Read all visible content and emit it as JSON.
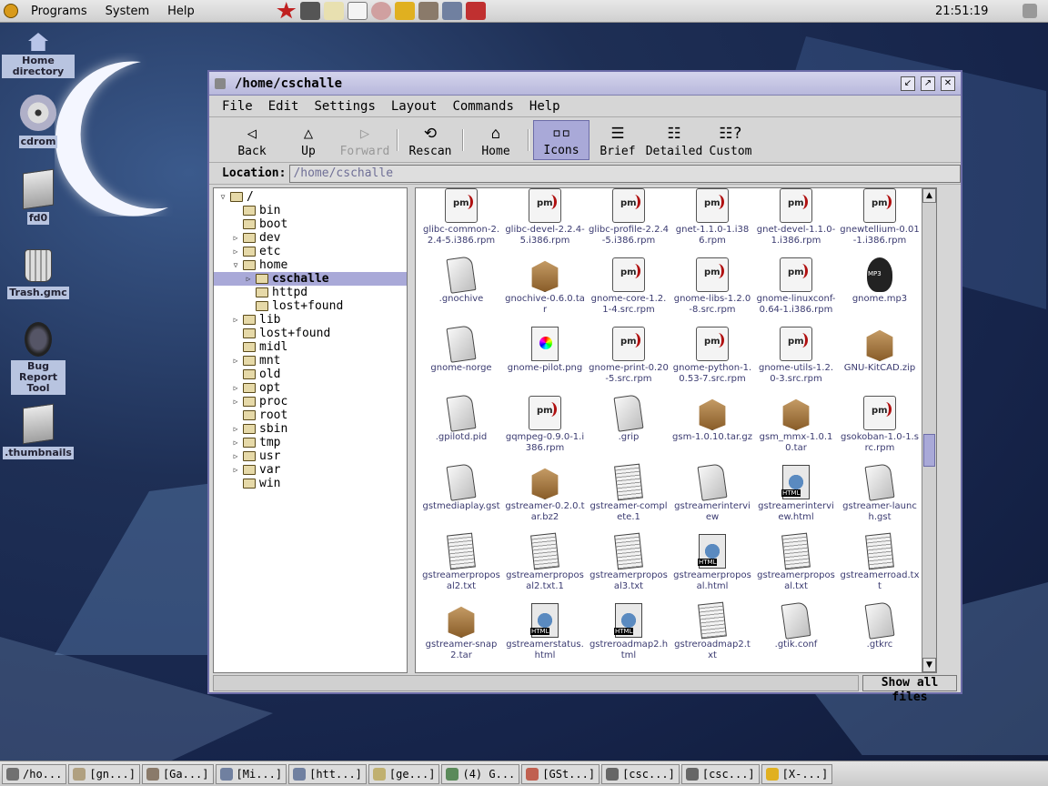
{
  "top_panel": {
    "menus": [
      "Programs",
      "System",
      "Help"
    ],
    "clock": "21:51:19"
  },
  "desktop_icons": [
    {
      "label": "Home directory",
      "icon": "home-icon"
    },
    {
      "label": "cdrom",
      "icon": "cdrom-icon"
    },
    {
      "label": "fd0",
      "icon": "floppy-folder-icon"
    },
    {
      "label": "Trash.gmc",
      "icon": "trash-icon"
    },
    {
      "label": "Bug Report Tool",
      "icon": "bug-icon"
    },
    {
      "label": ".thumbnails",
      "icon": "folder-icon"
    }
  ],
  "window": {
    "title": "/home/cschalle",
    "menus": [
      "File",
      "Edit",
      "Settings",
      "Layout",
      "Commands",
      "Help"
    ],
    "toolbar": [
      {
        "label": "Back",
        "icon": "back-arrow-icon"
      },
      {
        "label": "Up",
        "icon": "up-arrow-icon"
      },
      {
        "label": "Forward",
        "icon": "forward-arrow-icon",
        "disabled": true
      },
      {
        "label": "Rescan",
        "icon": "rescan-icon"
      },
      {
        "label": "Home",
        "icon": "home-icon"
      },
      {
        "label": "Icons",
        "icon": "icons-view-icon",
        "active": true
      },
      {
        "label": "Brief",
        "icon": "brief-view-icon"
      },
      {
        "label": "Detailed",
        "icon": "detailed-view-icon"
      },
      {
        "label": "Custom",
        "icon": "custom-view-icon"
      }
    ],
    "location_label": "Location:",
    "location_value": "/home/cschalle",
    "tree": [
      {
        "name": "/",
        "level": 0,
        "expander": "▽"
      },
      {
        "name": "bin",
        "level": 1,
        "expander": ""
      },
      {
        "name": "boot",
        "level": 1,
        "expander": ""
      },
      {
        "name": "dev",
        "level": 1,
        "expander": "▷"
      },
      {
        "name": "etc",
        "level": 1,
        "expander": "▷"
      },
      {
        "name": "home",
        "level": 1,
        "expander": "▽"
      },
      {
        "name": "cschalle",
        "level": 2,
        "expander": "▷",
        "selected": true
      },
      {
        "name": "httpd",
        "level": 2,
        "expander": ""
      },
      {
        "name": "lost+found",
        "level": 2,
        "expander": ""
      },
      {
        "name": "lib",
        "level": 1,
        "expander": "▷"
      },
      {
        "name": "lost+found",
        "level": 1,
        "expander": ""
      },
      {
        "name": "midl",
        "level": 1,
        "expander": ""
      },
      {
        "name": "mnt",
        "level": 1,
        "expander": "▷"
      },
      {
        "name": "old",
        "level": 1,
        "expander": ""
      },
      {
        "name": "opt",
        "level": 1,
        "expander": "▷"
      },
      {
        "name": "proc",
        "level": 1,
        "expander": "▷"
      },
      {
        "name": "root",
        "level": 1,
        "expander": ""
      },
      {
        "name": "sbin",
        "level": 1,
        "expander": "▷"
      },
      {
        "name": "tmp",
        "level": 1,
        "expander": "▷"
      },
      {
        "name": "usr",
        "level": 1,
        "expander": "▷"
      },
      {
        "name": "var",
        "level": 1,
        "expander": "▷"
      },
      {
        "name": "win",
        "level": 1,
        "expander": ""
      }
    ],
    "files": [
      {
        "name": "glibc-common-2.2.4-5.i386.rpm",
        "type": "rpm"
      },
      {
        "name": "glibc-devel-2.2.4-5.i386.rpm",
        "type": "rpm"
      },
      {
        "name": "glibc-profile-2.2.4-5.i386.rpm",
        "type": "rpm"
      },
      {
        "name": "gnet-1.1.0-1.i386.rpm",
        "type": "rpm"
      },
      {
        "name": "gnet-devel-1.1.0-1.i386.rpm",
        "type": "rpm"
      },
      {
        "name": "gnewtellium-0.01-1.i386.rpm",
        "type": "rpm"
      },
      {
        "name": ".gnochive",
        "type": "doc"
      },
      {
        "name": "gnochive-0.6.0.tar",
        "type": "tar"
      },
      {
        "name": "gnome-core-1.2.1-4.src.rpm",
        "type": "rpm"
      },
      {
        "name": "gnome-libs-1.2.0-8.src.rpm",
        "type": "rpm"
      },
      {
        "name": "gnome-linuxconf-0.64-1.i386.rpm",
        "type": "rpm"
      },
      {
        "name": "gnome.mp3",
        "type": "mp3"
      },
      {
        "name": "gnome-norge",
        "type": "doc"
      },
      {
        "name": "gnome-pilot.png",
        "type": "png"
      },
      {
        "name": "gnome-print-0.20-5.src.rpm",
        "type": "rpm"
      },
      {
        "name": "gnome-python-1.0.53-7.src.rpm",
        "type": "rpm"
      },
      {
        "name": "gnome-utils-1.2.0-3.src.rpm",
        "type": "rpm"
      },
      {
        "name": "GNU-KitCAD.zip",
        "type": "tar"
      },
      {
        "name": ".gpilotd.pid",
        "type": "doc"
      },
      {
        "name": "gqmpeg-0.9.0-1.i386.rpm",
        "type": "rpm"
      },
      {
        "name": ".grip",
        "type": "doc"
      },
      {
        "name": "gsm-1.0.10.tar.gz",
        "type": "tar"
      },
      {
        "name": "gsm_mmx-1.0.10.tar",
        "type": "tar"
      },
      {
        "name": "gsokoban-1.0-1.src.rpm",
        "type": "rpm"
      },
      {
        "name": "gstmediaplay.gst",
        "type": "doc"
      },
      {
        "name": "gstreamer-0.2.0.tar.bz2",
        "type": "tar"
      },
      {
        "name": "gstreamer-complete.1",
        "type": "txt"
      },
      {
        "name": "gstreamerinterview",
        "type": "doc"
      },
      {
        "name": "gstreamerinterview.html",
        "type": "html"
      },
      {
        "name": "gstreamer-launch.gst",
        "type": "doc"
      },
      {
        "name": "gstreamerproposal2.txt",
        "type": "txt"
      },
      {
        "name": "gstreamerproposal2.txt.1",
        "type": "txt"
      },
      {
        "name": "gstreamerproposal3.txt",
        "type": "txt"
      },
      {
        "name": "gstreamerproposal.html",
        "type": "html"
      },
      {
        "name": "gstreamerproposal.txt",
        "type": "txt"
      },
      {
        "name": "gstreamerroad.txt",
        "type": "txt"
      },
      {
        "name": "gstreamer-snap2.tar",
        "type": "tar"
      },
      {
        "name": "gstreamerstatus.html",
        "type": "html"
      },
      {
        "name": "gstreroadmap2.html",
        "type": "html"
      },
      {
        "name": "gstreroadmap2.txt",
        "type": "txt"
      },
      {
        "name": ".gtik.conf",
        "type": "doc"
      },
      {
        "name": ".gtkrc",
        "type": "doc"
      }
    ],
    "status_right": "Show all files"
  },
  "taskbar": [
    {
      "label": "/ho..."
    },
    {
      "label": "[gn...]"
    },
    {
      "label": "[Ga...]"
    },
    {
      "label": "[Mi...]"
    },
    {
      "label": "[htt...]"
    },
    {
      "label": "[ge...]"
    },
    {
      "label": "(4) G..."
    },
    {
      "label": "[GSt...]"
    },
    {
      "label": "[csc...]"
    },
    {
      "label": "[csc...]"
    },
    {
      "label": "[X-...]"
    }
  ],
  "colors": {
    "selection": "#a9a9d8",
    "window_border": "#6c6ca8",
    "file_label": "#3a3a70"
  }
}
